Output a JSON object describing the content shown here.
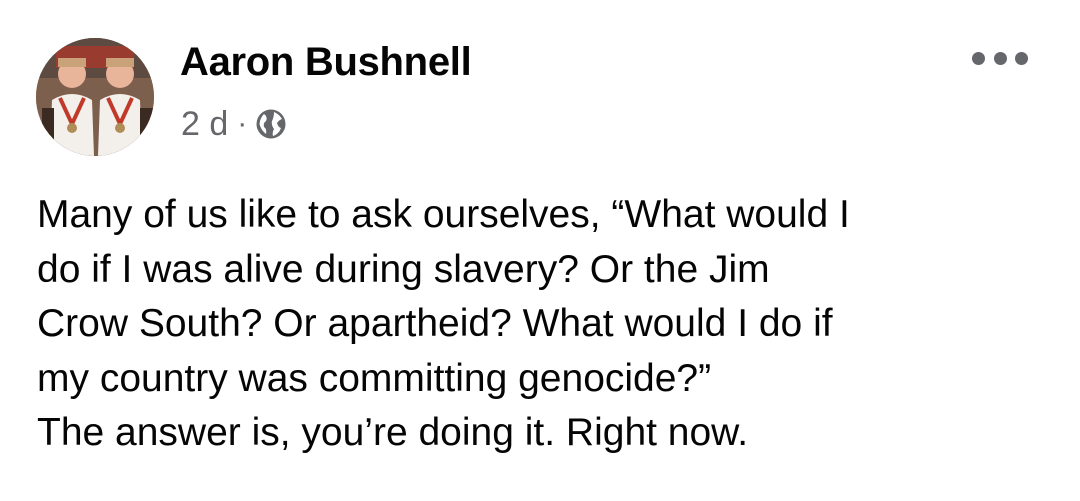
{
  "post": {
    "author": {
      "name": "Aaron Bushnell",
      "avatar_icon": "profile-photo-two-people"
    },
    "meta": {
      "timestamp": "2 d",
      "separator": "·",
      "audience_icon": "globe-icon"
    },
    "more_options_icon": "more-horizontal-icon",
    "body_lines": [
      "Many of us like to ask ourselves, “What would I",
      "do if I was alive during slavery? Or the Jim",
      "Crow South? Or apartheid? What would I do if",
      "my country was committing genocide?”",
      "The answer is, you’re doing it. Right now."
    ]
  },
  "colors": {
    "text_primary": "#050505",
    "text_secondary": "#65676b",
    "background": "#ffffff"
  }
}
